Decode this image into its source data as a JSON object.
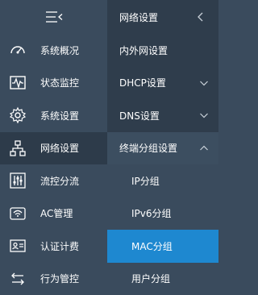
{
  "left_nav": {
    "items": [
      {
        "label": "系统概况",
        "icon": "speedometer-icon"
      },
      {
        "label": "状态监控",
        "icon": "monitor-pulse-icon"
      },
      {
        "label": "系统设置",
        "icon": "gear-icon"
      },
      {
        "label": "网络设置",
        "icon": "network-tree-icon"
      },
      {
        "label": "流控分流",
        "icon": "sliders-icon"
      },
      {
        "label": "AC管理",
        "icon": "wifi-router-icon"
      },
      {
        "label": "认证计费",
        "icon": "id-card-icon"
      },
      {
        "label": "行为管控",
        "icon": "arrows-exchange-icon"
      }
    ]
  },
  "submenu": {
    "title": "网络设置",
    "items": [
      {
        "label": "内外网设置"
      },
      {
        "label": "DHCP设置"
      },
      {
        "label": "DNS设置"
      },
      {
        "label": "终端分组设置"
      },
      {
        "label": "IP分组"
      },
      {
        "label": "IPv6分组"
      },
      {
        "label": "MAC分组"
      },
      {
        "label": "用户分组"
      }
    ]
  },
  "colors": {
    "nav_bg": "#3a4b5d",
    "submenu_bg": "#2f3d4c",
    "selected": "#1e88d0"
  }
}
